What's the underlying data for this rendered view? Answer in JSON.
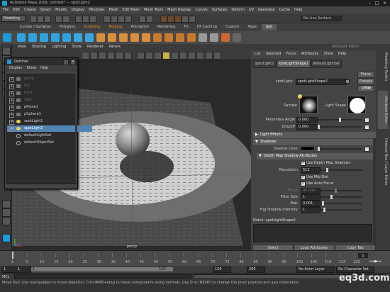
{
  "window": {
    "title": "Autodesk Maya 2016: untitled*  ---  spotLight2"
  },
  "menubar": [
    "File",
    "Edit",
    "Create",
    "Select",
    "Modify",
    "Display",
    "Windows",
    "Mesh",
    "Edit Mesh",
    "Mesh Tools",
    "Mesh Display",
    "Curves",
    "Surfaces",
    "Deform",
    "UV",
    "Generate",
    "Cache",
    "Help"
  ],
  "status_line": {
    "mode": "Modeling",
    "symmetry": "No Live Surface"
  },
  "shelf_tabs": [
    {
      "label": "Curves / Surfaces",
      "active": false
    },
    {
      "label": "Polygons",
      "active": false
    },
    {
      "label": "Sculpting",
      "active": false
    },
    {
      "label": "Rigging",
      "active": false
    },
    {
      "label": "Animation",
      "active": false
    },
    {
      "label": "Rendering",
      "active": false
    },
    {
      "label": "FX",
      "active": false
    },
    {
      "label": "FX Caching",
      "active": false
    },
    {
      "label": "Custom",
      "active": false
    },
    {
      "label": "XGen",
      "active": false
    },
    {
      "label": "test",
      "active": true
    }
  ],
  "viewport": {
    "menu": [
      "View",
      "Shading",
      "Lighting",
      "Show",
      "Renderer",
      "Panels"
    ],
    "camera_label": "persp"
  },
  "outliner": {
    "title": "Outliner",
    "menu": [
      "Display",
      "Show",
      "Help"
    ],
    "items": [
      {
        "label": "persp",
        "dim": true,
        "type": "camera"
      },
      {
        "label": "top",
        "dim": true,
        "type": "camera"
      },
      {
        "label": "front",
        "dim": true,
        "type": "camera"
      },
      {
        "label": "side",
        "dim": true,
        "type": "camera"
      },
      {
        "label": "pPlane1",
        "dim": false,
        "type": "mesh"
      },
      {
        "label": "pSphere1",
        "dim": false,
        "type": "mesh"
      },
      {
        "label": "spotLight1",
        "dim": false,
        "type": "light"
      },
      {
        "label": "spotLight2",
        "dim": false,
        "type": "light",
        "selected": true
      },
      {
        "label": "defaultLightSet",
        "dim": false,
        "type": "set"
      },
      {
        "label": "defaultObjectSet",
        "dim": false,
        "type": "set"
      }
    ]
  },
  "attribute_editor": {
    "header": "Attribute Editor",
    "menu": [
      "List",
      "Selected",
      "Focus",
      "Attributes",
      "Show",
      "Help"
    ],
    "tabs": [
      "spotLight2",
      "spotLightShape2",
      "defaultLightSet"
    ],
    "active_tab": "spotLightShape2",
    "buttons": {
      "focus": "Focus",
      "presets": "Presets",
      "show": "Show",
      "hide": "Hide"
    },
    "node_label": "spotLight:",
    "node_value": "spotLightShape2",
    "sample_label": "Sample",
    "light_shape_label": "Light Shape",
    "penumbra_label": "Penumbra Angle",
    "penumbra_value": "0.000",
    "dropoff_label": "Dropoff",
    "dropoff_value": "0.000",
    "sections": {
      "light_effects": "Light Effects",
      "shadows": "Shadows",
      "depth_map": "Depth Map Shadow Attributes"
    },
    "shadow_color_label": "Shadow Color",
    "use_depth_map": "Use Depth Map Shadows",
    "resolution_label": "Resolution",
    "resolution_value": "512",
    "use_mid_dist": "Use Mid Dist",
    "use_auto_focus": "Use Auto Focus",
    "focus_label": "Focus",
    "focus_value": "90.000",
    "filter_size_label": "Filter Size",
    "filter_size_value": "1",
    "bias_label": "Bias",
    "bias_value": "0.001",
    "fog_label": "Fog Shadow Intensity",
    "fog_value": "1",
    "notes_label": "Notes: spotLightShape2",
    "bottom": {
      "select": "Select",
      "load": "Load Attributes",
      "copy": "Copy Tab"
    }
  },
  "side_tabs": [
    "Modeling Toolkit",
    "Attribute Editor",
    "Channel Box / Layer Editor"
  ],
  "time_slider": {
    "ticks": [
      "1",
      "5",
      "10",
      "15",
      "20",
      "25",
      "30",
      "35",
      "40",
      "45",
      "50",
      "55",
      "60",
      "65",
      "70",
      "75",
      "80",
      "85",
      "90",
      "95",
      "100",
      "105",
      "110",
      "115",
      "120"
    ],
    "current": "1"
  },
  "range_slider": {
    "start": "1",
    "inner_start": "1",
    "inner_end": "120",
    "end": "120",
    "end2": "200",
    "anim_layer": "No Anim Layer",
    "char_set": "No Character Set"
  },
  "mel_label": "MEL",
  "help_line": "Move Tool: Use manipulator to move object(s). Ctrl+MMB+drag to move components along normals. Use D or INSERT to change the pivot position and axis orientation.",
  "watermark": "eq3d.com",
  "colors": {
    "selection": "#5284b3",
    "maya_blue": "#1a9bd7",
    "orange": "#e58a2a"
  }
}
